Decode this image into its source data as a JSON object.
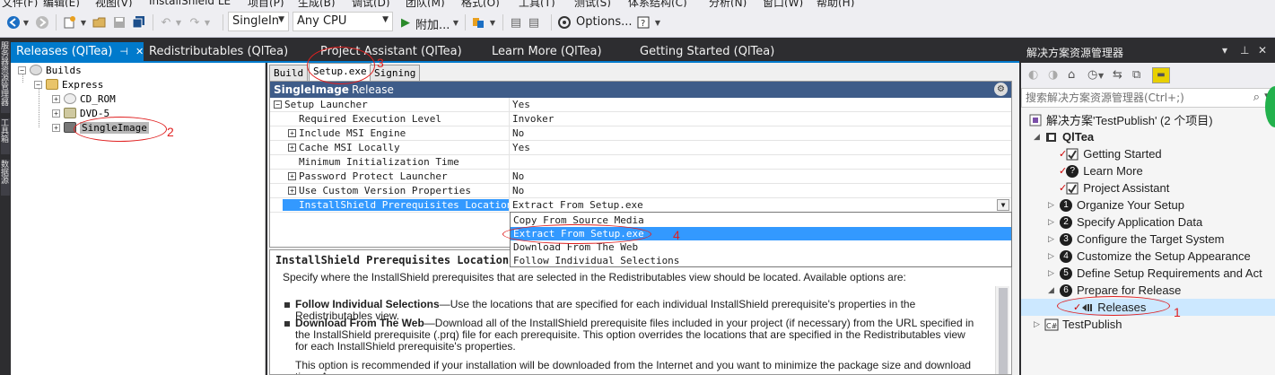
{
  "menubar": {
    "items": [
      "文件(F)",
      "编辑(E)",
      "视图(V)",
      "InstallShield LE",
      "项目(P)",
      "生成(B)",
      "调试(D)",
      "团队(M)",
      "格式(O)",
      "工具(T)",
      "测试(S)",
      "体系结构(C)",
      "分析(N)",
      "窗口(W)",
      "帮助(H)"
    ]
  },
  "toolbar": {
    "config_value": "SingleIn",
    "platform_value": "Any CPU",
    "attach_label": "附加...",
    "options_label": "Options..."
  },
  "vstrip": {
    "labels": [
      "服务器资源管理器",
      "工具箱",
      "数据源"
    ]
  },
  "doc_tabs": [
    {
      "label": "Releases (QlTea)",
      "active": true
    },
    {
      "label": "Redistributables (QlTea)"
    },
    {
      "label": "Project Assistant (QlTea)"
    },
    {
      "label": "Learn More (QlTea)"
    },
    {
      "label": "Getting Started (QlTea)"
    }
  ],
  "releases_tree": {
    "root": "Builds",
    "child": "Express",
    "items": [
      "CD_ROM",
      "DVD-5",
      "SingleImage"
    ]
  },
  "inner_tabs": [
    "Build",
    "Setup.exe",
    "Signing"
  ],
  "property_grid": {
    "header_title": "SingleImage",
    "header_sub": "Release",
    "rows": [
      {
        "name": "Setup Launcher",
        "value": "Yes"
      },
      {
        "name": "Required Execution Level",
        "value": "Invoker"
      },
      {
        "name": "Include MSI Engine",
        "value": "No"
      },
      {
        "name": "Cache MSI Locally",
        "value": "Yes"
      },
      {
        "name": "Minimum Initialization Time",
        "value": ""
      },
      {
        "name": "Password Protect Launcher",
        "value": "No"
      },
      {
        "name": "Use Custom Version Properties",
        "value": "No"
      },
      {
        "name": "InstallShield Prerequisites Location",
        "value": "Extract From Setup.exe"
      }
    ],
    "dropdown_options": [
      "Copy From Source Media",
      "Extract From Setup.exe",
      "Download From The Web",
      "Follow Individual Selections"
    ],
    "dropdown_selected": "Extract From Setup.exe"
  },
  "help": {
    "title": "InstallShield Prerequisites Location",
    "intro": "Specify where the InstallShield prerequisites that are selected in the Redistributables view should be located. Available options are:",
    "bullets": [
      {
        "bold": "Follow Individual Selections",
        "text": "—Use the locations that are specified for each individual InstallShield prerequisite's properties in the Redistributables view."
      },
      {
        "bold": "Download From The Web",
        "text": "—Download all of the InstallShield prerequisite files included in your project (if necessary) from the URL specified in the InstallShield prerequisite (.prq) file for each prerequisite. This option overrides the locations that are specified in the Redistributables view for each InstallShield prerequisite's properties."
      }
    ],
    "note": "This option is recommended if your installation will be downloaded from the Internet and you want to minimize the package size and download time. An"
  },
  "solution_explorer": {
    "title": "解决方案资源管理器",
    "search_placeholder": "搜索解决方案资源管理器(Ctrl+;)",
    "solution": "解决方案'TestPublish' (2 个项目)",
    "project": "QlTea",
    "items": [
      {
        "label": "Getting Started",
        "num": ""
      },
      {
        "label": "Learn More",
        "num": ""
      },
      {
        "label": "Project Assistant",
        "num": ""
      },
      {
        "label": "Organize Your Setup",
        "num": "1"
      },
      {
        "label": "Specify Application Data",
        "num": "2"
      },
      {
        "label": "Configure the Target System",
        "num": "3"
      },
      {
        "label": "Customize the Setup Appearance",
        "num": "4"
      },
      {
        "label": "Define Setup Requirements and Act",
        "num": "5"
      },
      {
        "label": "Prepare for Release",
        "num": "6"
      }
    ],
    "releases": "Releases",
    "other_project": "TestPublish"
  },
  "annotations": [
    "1",
    "2",
    "3",
    "4"
  ],
  "colors": {
    "accent": "#007acc",
    "selection": "#3399ff",
    "annotation": "#e02020"
  }
}
